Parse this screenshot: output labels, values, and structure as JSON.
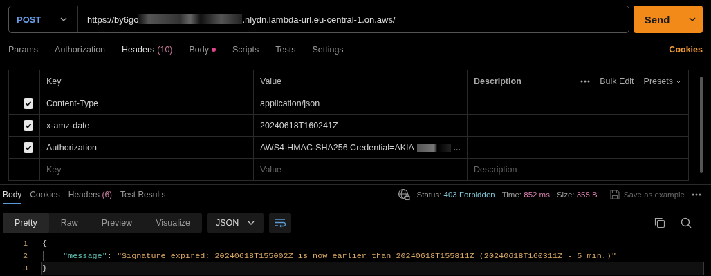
{
  "request": {
    "method": "POST",
    "url_start": "https://by6go",
    "url_redacted": true,
    "url_end": ".nlydn.lambda-url.eu-central-1.on.aws/",
    "send": "Send"
  },
  "request_tabs": [
    {
      "label": "Params",
      "dot": false,
      "selected": false
    },
    {
      "label": "Authorization",
      "dot": false,
      "selected": false
    },
    {
      "label": "Headers",
      "count": "(10)",
      "dot": false,
      "selected": true
    },
    {
      "label": "Body",
      "dot": true,
      "selected": false
    },
    {
      "label": "Scripts",
      "dot": false,
      "selected": false
    },
    {
      "label": "Tests",
      "dot": false,
      "selected": false
    },
    {
      "label": "Settings",
      "dot": false,
      "selected": false
    }
  ],
  "cookies_link": "Cookies",
  "headers_table": {
    "columns": [
      "Key",
      "Value",
      "Description"
    ],
    "bulk_edit": "Bulk Edit",
    "presets": "Presets",
    "rows": [
      {
        "checked": true,
        "key": "Content-Type",
        "value": "application/json",
        "redacted": false
      },
      {
        "checked": true,
        "key": "x-amz-date",
        "value": "20240618T160241Z",
        "redacted": false
      },
      {
        "checked": true,
        "key": "Authorization",
        "value": "AWS4-HMAC-SHA256 Credential=AKIA",
        "redacted": true,
        "value_tail": "..."
      }
    ],
    "new_row": {
      "key_placeholder": "Key",
      "value_placeholder": "Value",
      "description_placeholder": "Description"
    }
  },
  "response": {
    "tabs": [
      {
        "label": "Body",
        "selected": true
      },
      {
        "label": "Cookies",
        "selected": false
      },
      {
        "label": "Headers",
        "count": "(6)",
        "selected": false
      },
      {
        "label": "Test Results",
        "selected": false
      }
    ],
    "status_label": "Status:",
    "status_value": "403 Forbidden",
    "time_label": "Time:",
    "time_value": "852 ms",
    "size_label": "Size:",
    "size_value": "355 B",
    "save_example": "Save as example",
    "view_modes": [
      {
        "label": "Pretty",
        "selected": true
      },
      {
        "label": "Raw",
        "selected": false
      },
      {
        "label": "Preview",
        "selected": false
      },
      {
        "label": "Visualize",
        "selected": false
      }
    ],
    "format": "JSON",
    "lines": [
      {
        "number": "1",
        "kind": "brace",
        "text": "{",
        "active": false
      },
      {
        "number": "2",
        "kind": "pair",
        "text": ": ",
        "key": "\"message\"",
        "value": "\"Signature expired: 20240618T155002Z is now earlier than 20240618T155811Z (20240618T160311Z - 5 min.)\"",
        "active": false
      },
      {
        "number": "3",
        "kind": "brace",
        "text": "}",
        "active": true
      }
    ]
  }
}
